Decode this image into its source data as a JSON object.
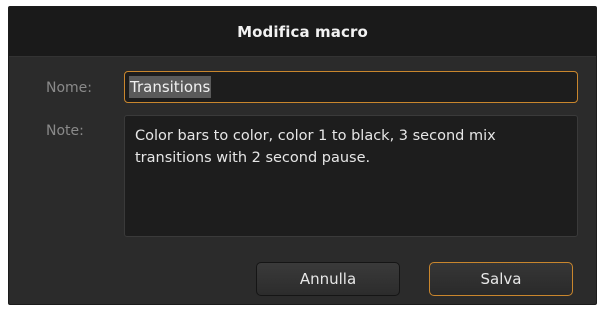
{
  "dialog": {
    "title": "Modifica macro"
  },
  "form": {
    "name_label": "Nome:",
    "name_value": "Transitions",
    "note_label": "Note:",
    "note_value": "Color bars to color, color 1 to black, 3 second mix\ntransitions with 2 second pause."
  },
  "buttons": {
    "cancel_label": "Annulla",
    "save_label": "Salva"
  },
  "colors": {
    "accent": "#c9862d",
    "dialog_bg": "#2b2b2b",
    "titlebar_bg": "#1a1a1a",
    "field_bg": "#1d1d1d"
  }
}
